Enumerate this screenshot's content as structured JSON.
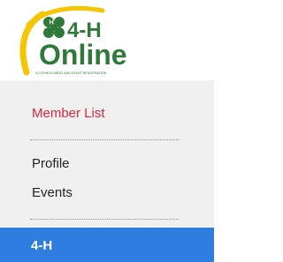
{
  "logo": {
    "brand_top": "4-H",
    "brand_bottom": "Online",
    "tagline": "4-H ENROLLMENT AND EVENT REGISTRATION",
    "colors": {
      "green": "#2f7a3a",
      "swoosh": "#f4c500"
    }
  },
  "menu": {
    "items": [
      {
        "label": "Member List",
        "active": true
      },
      {
        "label": "Profile",
        "active": false
      },
      {
        "label": "Events",
        "active": false
      }
    ]
  },
  "program_bar": {
    "label": "4-H",
    "color": "#2f7de1"
  },
  "colors": {
    "active": "#d7263d",
    "panel": "#f0f0f0"
  }
}
